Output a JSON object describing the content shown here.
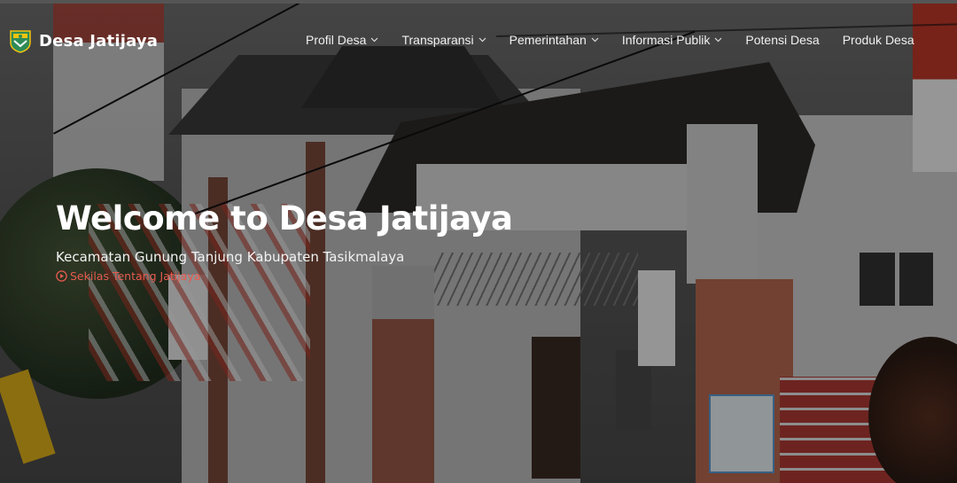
{
  "site": {
    "brand_name": "Desa Jatijaya",
    "logo_icon": "regency-crest-icon"
  },
  "nav": {
    "items": [
      {
        "label": "Profil Desa",
        "has_dropdown": true
      },
      {
        "label": "Transparansi",
        "has_dropdown": true
      },
      {
        "label": "Pemerintahan",
        "has_dropdown": true
      },
      {
        "label": "Informasi Publik",
        "has_dropdown": true
      },
      {
        "label": "Potensi Desa",
        "has_dropdown": false
      },
      {
        "label": "Produk Desa",
        "has_dropdown": false
      }
    ]
  },
  "hero": {
    "title": "Welcome to Desa Jatijaya",
    "subtitle": "Kecamatan Gunung Tanjung Kabupaten Tasikmalaya",
    "link_label": "Sekilas Tentang Jatijaya",
    "link_icon": "play-circle-icon"
  },
  "colors": {
    "accent": "#e85a4f",
    "text": "#ffffff"
  }
}
